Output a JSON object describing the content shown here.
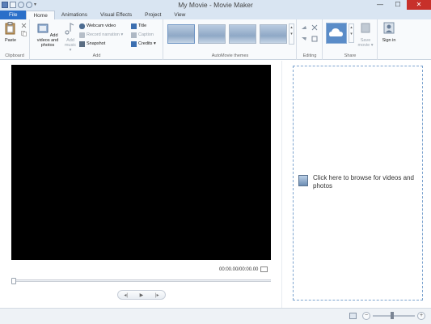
{
  "window": {
    "title": "My Movie - Movie Maker",
    "minimize": "—",
    "maximize": "☐",
    "close": "✕"
  },
  "quick_access": {
    "dropdown": "▾"
  },
  "tabs": [
    {
      "label": "File"
    },
    {
      "label": "Home"
    },
    {
      "label": "Animations"
    },
    {
      "label": "Visual Effects"
    },
    {
      "label": "Project"
    },
    {
      "label": "View"
    }
  ],
  "ribbon": {
    "clipboard": {
      "label": "Clipboard",
      "paste": "Paste"
    },
    "add": {
      "label": "Add",
      "add_videos": "Add videos and photos",
      "add_music": "Add music ▾",
      "webcam": "Webcam video",
      "narration": "Record narration ▾",
      "snapshot": "Snapshot",
      "title": "Title",
      "caption": "Caption",
      "credits": "Credits ▾"
    },
    "themes": {
      "label": "AutoMovie themes"
    },
    "editing": {
      "label": "Editing"
    },
    "share": {
      "label": "Share",
      "save_movie": "Save movie ▾"
    },
    "signin": {
      "label": "Sign in"
    }
  },
  "player": {
    "timecode": "00:00.00/00:00.00",
    "prev": "◂|",
    "play": "▶",
    "next": "|▸"
  },
  "storyboard": {
    "browse_text": "Click here to browse for videos and photos"
  },
  "status": {
    "zoom_minus": "−",
    "zoom_plus": "+",
    "zoom_level": 0.45
  }
}
